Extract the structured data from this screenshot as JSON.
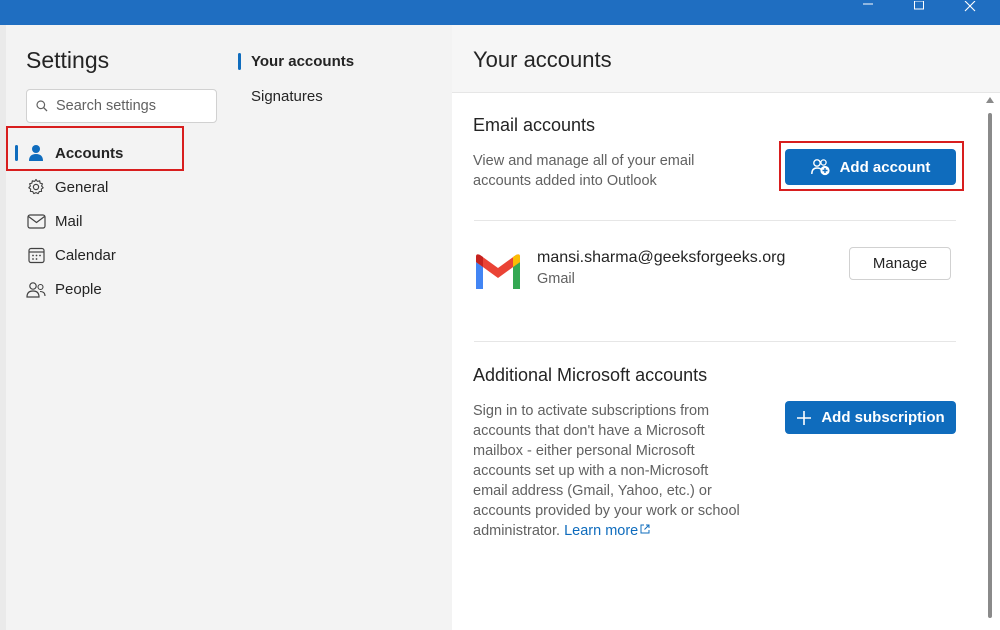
{
  "window": {
    "controls": [
      "minimize",
      "maximize",
      "close"
    ]
  },
  "nav": {
    "title": "Settings",
    "search_placeholder": "Search settings",
    "items": [
      {
        "label": "Accounts",
        "icon": "person-icon",
        "active": true
      },
      {
        "label": "General",
        "icon": "gear-icon"
      },
      {
        "label": "Mail",
        "icon": "mail-icon"
      },
      {
        "label": "Calendar",
        "icon": "calendar-icon"
      },
      {
        "label": "People",
        "icon": "people-icon"
      }
    ]
  },
  "subnav": {
    "items": [
      {
        "label": "Your accounts",
        "active": true
      },
      {
        "label": "Signatures"
      }
    ]
  },
  "content": {
    "title": "Your accounts",
    "email_accounts": {
      "heading": "Email accounts",
      "description_line1": "View and manage all of your email",
      "description_line2": "accounts added into Outlook",
      "add_button": "Add account",
      "account": {
        "email": "mansi.sharma@geeksforgeeks.org",
        "type": "Gmail",
        "manage_button": "Manage"
      }
    },
    "additional": {
      "heading": "Additional Microsoft accounts",
      "lines": [
        "Sign in to activate subscriptions from",
        "accounts that don't have a Microsoft",
        "mailbox - either personal Microsoft",
        "accounts set up with a non-Microsoft",
        "email address (Gmail, Yahoo, etc.) or",
        "accounts provided by your work or school"
      ],
      "last_line_prefix": "administrator.",
      "learn_more": "Learn more",
      "add_subscription_button": "Add subscription"
    }
  },
  "colors": {
    "accent": "#0f6cbd",
    "titlebar": "#1f6ec1",
    "highlight": "#d81e1e"
  }
}
